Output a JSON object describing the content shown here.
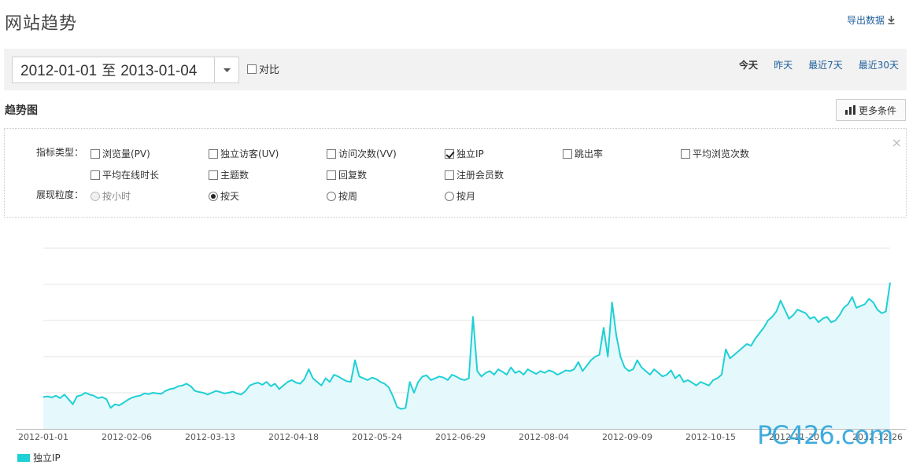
{
  "page": {
    "title": "网站趋势",
    "export_label": "导出数据"
  },
  "date_bar": {
    "start": "2012-01-01",
    "separator": "至",
    "end": "2013-01-04",
    "compare_label": "对比",
    "compare_checked": false,
    "quick_links": [
      {
        "label": "今天",
        "active": true
      },
      {
        "label": "昨天",
        "active": false
      },
      {
        "label": "最近7天",
        "active": false
      },
      {
        "label": "最近30天",
        "active": false
      }
    ]
  },
  "section": {
    "title": "趋势图",
    "more_label": "更多条件"
  },
  "options": {
    "metric_label": "指标类型：",
    "metrics": [
      {
        "label": "浏览量(PV)",
        "checked": false
      },
      {
        "label": "独立访客(UV)",
        "checked": false
      },
      {
        "label": "访问次数(VV)",
        "checked": false
      },
      {
        "label": "独立IP",
        "checked": true
      },
      {
        "label": "跳出率",
        "checked": false
      },
      {
        "label": "平均浏览次数",
        "checked": false
      },
      {
        "label": "平均在线时长",
        "checked": false
      },
      {
        "label": "主题数",
        "checked": false
      },
      {
        "label": "回复数",
        "checked": false
      },
      {
        "label": "注册会员数",
        "checked": false
      }
    ],
    "granularity_label": "展现粒度：",
    "granularity": [
      {
        "label": "按小时",
        "checked": false,
        "disabled": true
      },
      {
        "label": "按天",
        "checked": true,
        "disabled": false
      },
      {
        "label": "按周",
        "checked": false,
        "disabled": false
      },
      {
        "label": "按月",
        "checked": false,
        "disabled": false
      }
    ],
    "close_symbol": "×"
  },
  "chart_data": {
    "type": "area",
    "xlabel": "",
    "ylabel": "",
    "x_tick_labels": [
      "2012-01-01",
      "2012-02-06",
      "2012-03-13",
      "2012-04-18",
      "2012-05-24",
      "2012-06-29",
      "2012-08-04",
      "2012-09-09",
      "2012-10-15",
      "2012-11-20",
      "2012-12-26"
    ],
    "y_gridlines": 5,
    "ylim": [
      0,
      5
    ],
    "series": [
      {
        "name": "独立IP",
        "color": "#1fd0d4",
        "fill": "#e5f8fc",
        "x_start": "2012-01-01",
        "x_end": "2013-01-04",
        "values": [
          0.88,
          0.9,
          0.87,
          0.92,
          0.85,
          0.95,
          0.82,
          0.68,
          0.9,
          0.93,
          1.0,
          0.95,
          0.92,
          0.85,
          0.88,
          0.82,
          0.58,
          0.68,
          0.65,
          0.72,
          0.8,
          0.86,
          0.9,
          0.92,
          0.98,
          0.96,
          1.0,
          0.98,
          0.97,
          1.05,
          1.1,
          1.12,
          1.18,
          1.2,
          1.25,
          1.18,
          1.05,
          1.02,
          1.0,
          0.95,
          1.0,
          1.05,
          1.02,
          0.98,
          1.0,
          1.03,
          0.98,
          0.95,
          1.05,
          1.2,
          1.25,
          1.28,
          1.22,
          1.3,
          1.18,
          1.25,
          1.1,
          1.2,
          1.3,
          1.35,
          1.28,
          1.25,
          1.38,
          1.65,
          1.4,
          1.3,
          1.2,
          1.4,
          1.3,
          1.5,
          1.45,
          1.38,
          1.32,
          1.3,
          1.9,
          1.45,
          1.4,
          1.35,
          1.42,
          1.38,
          1.3,
          1.25,
          1.15,
          0.9,
          0.6,
          0.55,
          0.58,
          1.3,
          1.0,
          1.3,
          1.45,
          1.48,
          1.35,
          1.4,
          1.45,
          1.42,
          1.35,
          1.5,
          1.45,
          1.38,
          1.35,
          1.4,
          3.1,
          1.6,
          1.45,
          1.55,
          1.6,
          1.5,
          1.65,
          1.58,
          1.5,
          1.7,
          1.55,
          1.6,
          1.5,
          1.65,
          1.58,
          1.52,
          1.6,
          1.55,
          1.62,
          1.58,
          1.5,
          1.55,
          1.62,
          1.6,
          1.65,
          1.85,
          1.6,
          1.75,
          1.9,
          2.0,
          2.05,
          2.8,
          2.0,
          3.5,
          2.6,
          2.0,
          1.7,
          1.6,
          1.65,
          1.9,
          1.7,
          1.6,
          1.5,
          1.65,
          1.55,
          1.45,
          1.5,
          1.62,
          1.4,
          1.5,
          1.3,
          1.35,
          1.28,
          1.2,
          1.3,
          1.25,
          1.2,
          1.35,
          1.4,
          1.5,
          2.2,
          1.95,
          2.05,
          2.15,
          2.25,
          2.35,
          2.3,
          2.5,
          2.65,
          2.8,
          3.0,
          3.1,
          3.25,
          3.55,
          3.3,
          3.05,
          3.15,
          3.3,
          3.25,
          3.2,
          3.05,
          3.1,
          2.95,
          3.05,
          3.1,
          2.95,
          3.0,
          3.15,
          3.35,
          3.45,
          3.65,
          3.35,
          3.4,
          3.45,
          3.6,
          3.5,
          3.3,
          3.2,
          3.25,
          4.05
        ]
      }
    ]
  },
  "legend": {
    "label": "独立IP",
    "color": "#1fd0d4"
  },
  "watermark": "PC426.com"
}
